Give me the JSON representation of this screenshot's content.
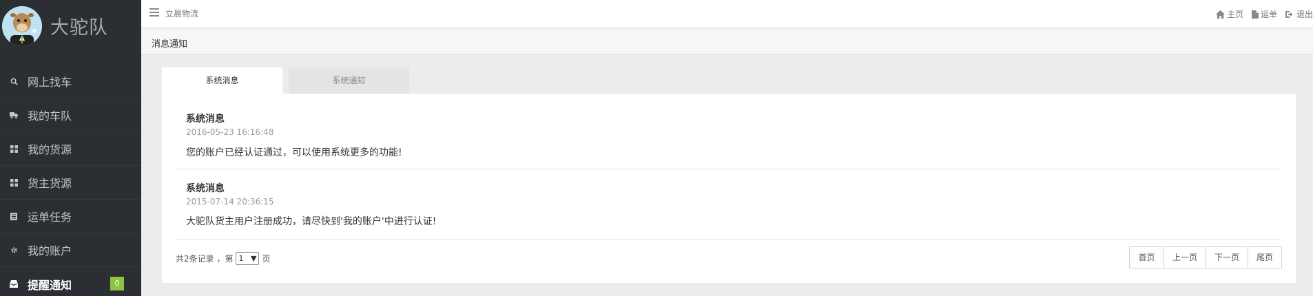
{
  "brand": {
    "name": "大驼队",
    "avatar_icon": "camel-avatar-icon"
  },
  "sidebar": {
    "items": [
      {
        "label": "网上找车",
        "icon": "search-icon"
      },
      {
        "label": "我的车队",
        "icon": "truck-icon"
      },
      {
        "label": "我的货源",
        "icon": "grid-icon"
      },
      {
        "label": "货主货源",
        "icon": "grid-icon"
      },
      {
        "label": "运单任务",
        "icon": "list-icon"
      },
      {
        "label": "我的账户",
        "icon": "gear-icon"
      },
      {
        "label": "提醒通知",
        "icon": "inbox-icon",
        "badge": "0",
        "active": true
      }
    ]
  },
  "topbar": {
    "company": "立晨物流",
    "links": {
      "home": "主页",
      "waybill": "运单",
      "logout": "退出"
    }
  },
  "page": {
    "title": "消息通知"
  },
  "tabs": [
    {
      "label": "系统消息",
      "active": true
    },
    {
      "label": "系统通知",
      "active": false
    }
  ],
  "messages": [
    {
      "title": "系统消息",
      "time": "2016-05-23 16:16:48",
      "body": "您的账户已经认证通过，可以使用系统更多的功能!"
    },
    {
      "title": "系统消息",
      "time": "2015-07-14 20:36:15",
      "body": "大驼队货主用户注册成功，请尽快到'我的账户'中进行认证!"
    }
  ],
  "pagination": {
    "summary_prefix": "共2条记录 ，第",
    "current_page": "1",
    "summary_suffix": "页",
    "buttons": {
      "first": "首页",
      "prev": "上一页",
      "next": "下一页",
      "last": "尾页"
    }
  },
  "colors": {
    "sidebar_bg": "#2b2e33",
    "badge": "#8cc53f",
    "page_bg": "#ececec"
  }
}
